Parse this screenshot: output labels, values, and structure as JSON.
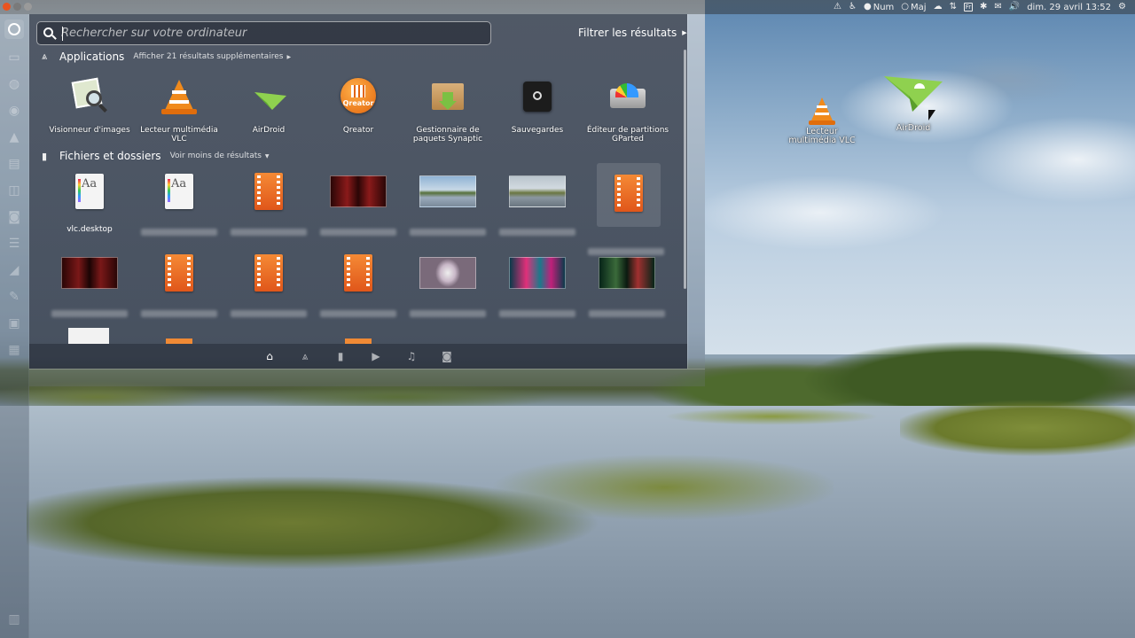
{
  "panel": {
    "num_label": "Num",
    "maj_label": "Maj",
    "keyboard_layout": "Fr",
    "datetime": "dim. 29 avril 13:52",
    "colors": {
      "close": "#e95420",
      "min": "#7a7a7a",
      "max": "#9a9a9a"
    }
  },
  "dash": {
    "search_placeholder": "Rechercher sur votre ordinateur",
    "search_value": "",
    "filter_label": "Filtrer les résultats",
    "applications": {
      "title": "Applications",
      "more": "Afficher 21 résultats supplémentaires",
      "items": [
        {
          "label": "Visionneur d'images",
          "icon": "image-viewer-icon"
        },
        {
          "label": "Lecteur multimédia VLC",
          "icon": "vlc-icon"
        },
        {
          "label": "AirDroid",
          "icon": "airdroid-icon"
        },
        {
          "label": "Qreator",
          "icon": "qreator-icon"
        },
        {
          "label": "Gestionnaire de paquets Synaptic",
          "icon": "synaptic-icon"
        },
        {
          "label": "Sauvegardes",
          "icon": "backup-icon"
        },
        {
          "label": "Éditeur de partitions GParted",
          "icon": "gparted-icon"
        }
      ]
    },
    "files": {
      "title": "Fichiers et dossiers",
      "more": "Voir moins de résultats",
      "first_file": "vlc.desktop"
    }
  },
  "desktop": {
    "vlc_label": "Lecteur multimédia VLC",
    "airdroid_label": "AirDroid"
  }
}
